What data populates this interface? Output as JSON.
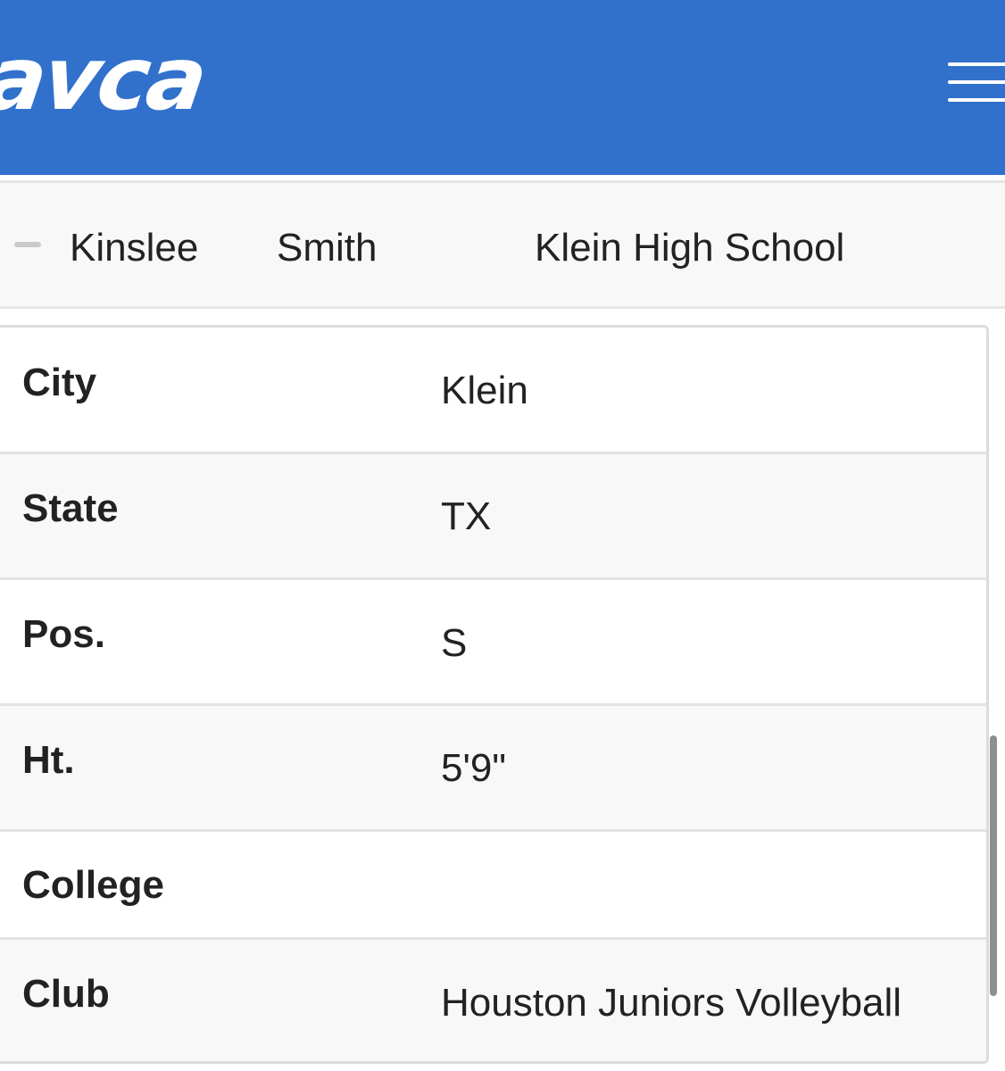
{
  "header": {
    "logo_text": "avca",
    "menu_icon": "hamburger-menu-icon",
    "background_color": "#3171cc"
  },
  "player": {
    "toggle_icon": "minus-icon",
    "first_name": "Kinslee",
    "last_name": "Smith",
    "school": "Klein High School"
  },
  "details": [
    {
      "label": "City",
      "value": "Klein"
    },
    {
      "label": "State",
      "value": "TX"
    },
    {
      "label": "Pos.",
      "value": "S"
    },
    {
      "label": "Ht.",
      "value": "5'9\""
    },
    {
      "label": "College",
      "value": ""
    },
    {
      "label": "Club",
      "value": "Houston Juniors Volleyball"
    }
  ]
}
